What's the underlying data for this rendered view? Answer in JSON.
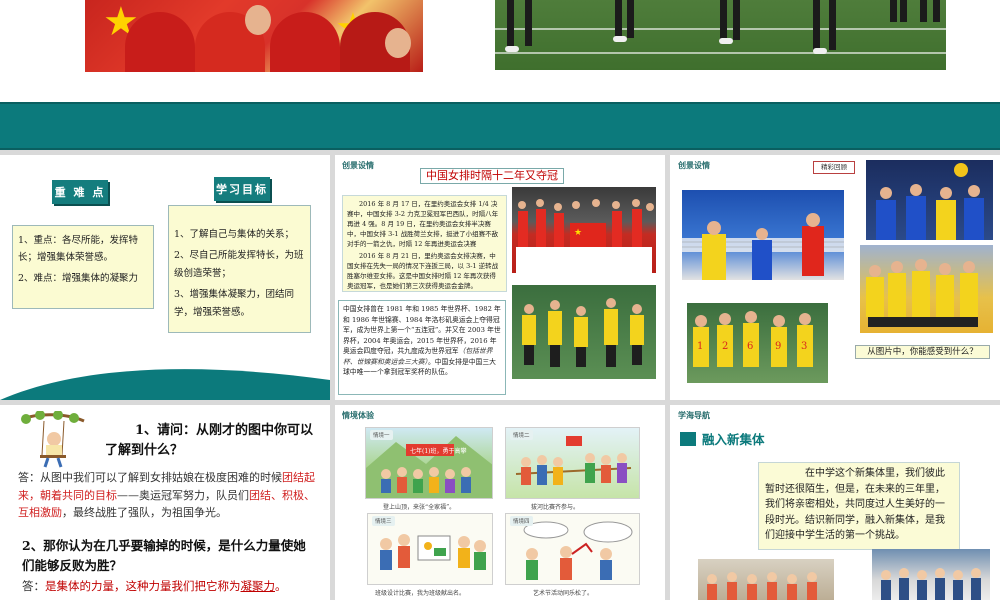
{
  "panel1": {
    "key_points_tag": "重 难 点",
    "objectives_tag": "学习目标",
    "key_points": [
      "1、重点：各尽所能，发挥特长；增强集体荣誉感。",
      "2、难点：增强集体的凝聚力"
    ],
    "objectives": [
      "1、了解自己与集体的关系；",
      "2、尽自己所能发挥特长，为班级创造荣誉；",
      "3、增强集体凝聚力，团结同学，增强荣誉感。"
    ]
  },
  "panel2": {
    "section_label": "创景设情",
    "title": "中国女排时隔十二年又夺冠",
    "para1": "2016 年 8 月 17 日，在里约奥运会女排 1/4 决赛中，中国女排 3-2 力克卫冕冠军巴西队，时隔八年再进 4 强。8 月 19 日，在里约奥运会女排半决赛中，中国女排 3-1 战胜荷兰女排，挺进了小组赛不敌对手的一箭之仇，时隔 12 年再进奥运会决赛",
    "para2": "2016 年 8 月 21 日，里约奥运会女排决赛，中国女排在先失一局的情况下连扳三局，以 3-1 逆转战胜塞尔维亚女排。这是中国女排时隔 12 年再次获得奥运冠军，也是她们第三次获得奥运会金牌。",
    "para3_before": "中国女排曾在 1981 年和 1985 年世界杯、1982 年和 1986 年世锦赛、1984 年洛杉矶奥运会上夺得冠军，成为世界上第一个“五连冠”。并又在 2003 年世界杯，2004 年奥运会，2015 年世界杯，2016 年奥运会四度夺冠，共九度成为世界冠军",
    "para3_italic": "（包括世界杯、世锦赛和奥运会三大赛）",
    "para3_after": "。中国女排是中国三大球中唯一一个拿到冠军奖杯的队伍。"
  },
  "panel3": {
    "section_label": "创景设情",
    "tag": "精彩回顾",
    "question": "从图片中，你能感受到什么？"
  },
  "panel4": {
    "q1_number": "1",
    "q1": "、请问：从刚才的图中你可以了解到什么？",
    "a1_prefix": "答：从图中我们可以了解到女排姑娘在极度困难的时候",
    "a1_red1": "团结起来，朝着共同的目标",
    "a1_mid": "——奥运冠军努力，队员们",
    "a1_red2": "团结、积极、互相激励",
    "a1_end": "，最终战胜了强队，为祖国争光。",
    "q2": "2、那你认为在几乎要输掉的时候，是什么力量使她们能够反败为胜？",
    "a2_prefix": "答：",
    "a2_main": "是集体的力量，这种力量我们把它称为",
    "a2_underlined": "凝聚力",
    "a2_end": "。"
  },
  "panel5": {
    "section_label": "情境体验",
    "scenes": [
      "情境一",
      "情境二",
      "情境三",
      "情境四"
    ],
    "captions": [
      "登上山顶，来张“全家福”。",
      "拔河比赛齐参与。",
      "班级设计比赛，我为班级献出名。",
      "艺术节活动同乐松了。"
    ],
    "banner": "七年(1)班，勇于高攀"
  },
  "panel6": {
    "section_label": "学海导航",
    "subtitle": "融入新集体",
    "body": "在中学这个新集体里，我们彼此暂时还很陌生，但是，在未来的三年里，我们将亲密相处，共同度过人生美好的一段时光。结识新同学，融入新集体，是我们迎接中学生活的第一个挑战。"
  }
}
